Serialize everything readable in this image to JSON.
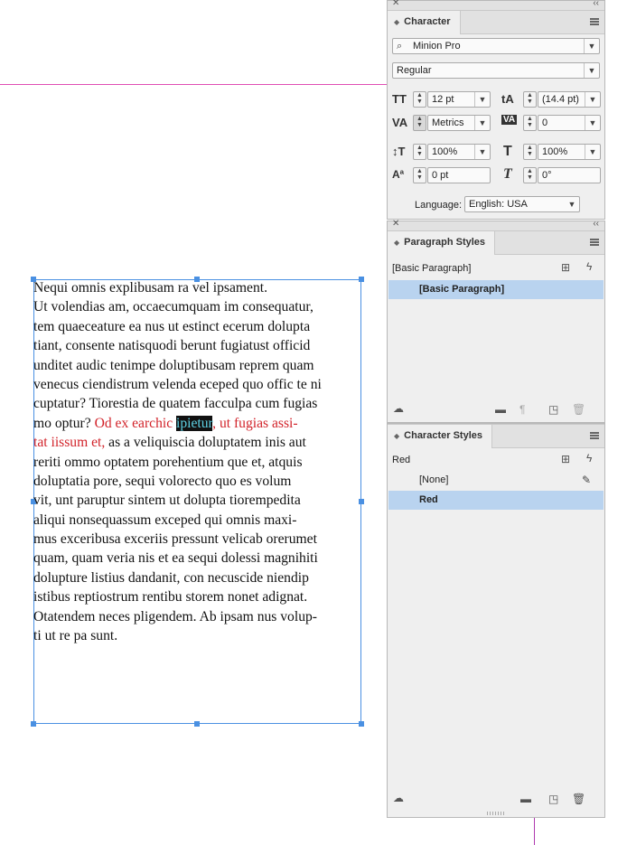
{
  "story": {
    "lines": [
      {
        "segments": [
          {
            "text": "Nequi omnis explibusam ra vel ipsament.",
            "style": "normal"
          }
        ]
      },
      {
        "segments": [
          {
            "text": "Ut volendias am, occaecumquam im consequatur,",
            "style": "normal"
          }
        ]
      },
      {
        "segments": [
          {
            "text": "tem quaeceature ea nus ut estinct ecerum dolupta",
            "style": "normal"
          }
        ]
      },
      {
        "segments": [
          {
            "text": "tiant, consente natisquodi berunt fugiatust officid",
            "style": "normal"
          }
        ]
      },
      {
        "segments": [
          {
            "text": "unditet audic tenimpe doluptibusam reprem quam",
            "style": "normal"
          }
        ]
      },
      {
        "segments": [
          {
            "text": "venecus ciendistrum velenda eceped quo offic te ni",
            "style": "normal"
          }
        ]
      },
      {
        "segments": [
          {
            "text": "cuptatur? Tiorestia de quatem facculpa cum fugias",
            "style": "normal"
          }
        ]
      },
      {
        "segments": [
          {
            "text": "mo optur? ",
            "style": "normal"
          },
          {
            "text": "Od ex earchic ",
            "style": "red"
          },
          {
            "text": "ipietur",
            "style": "selected"
          },
          {
            "text": ", ut fugias assi-",
            "style": "red"
          }
        ]
      },
      {
        "segments": [
          {
            "text": "tat iissum et,",
            "style": "red"
          },
          {
            "text": " as a veliquiscia doluptatem inis aut",
            "style": "normal"
          }
        ]
      },
      {
        "segments": [
          {
            "text": "reriti ommo optatem porehentium que et, atquis",
            "style": "normal"
          }
        ]
      },
      {
        "segments": [
          {
            "text": "doluptatia pore, sequi volorecto quo es volum",
            "style": "normal"
          }
        ]
      },
      {
        "segments": [
          {
            "text": "vit, unt paruptur sintem ut dolupta tiorempedita",
            "style": "normal"
          }
        ]
      },
      {
        "segments": [
          {
            "text": "aliqui nonsequassum exceped qui omnis maxi-",
            "style": "normal"
          }
        ]
      },
      {
        "segments": [
          {
            "text": "mus exceribusa exceriis pressunt velicab orerumet",
            "style": "normal"
          }
        ]
      },
      {
        "segments": [
          {
            "text": "quam, quam veria nis et ea sequi dolessi magnihiti",
            "style": "normal"
          }
        ]
      },
      {
        "segments": [
          {
            "text": "dolupture listius dandanit, con necuscide niendip",
            "style": "normal"
          }
        ]
      },
      {
        "segments": [
          {
            "text": "istibus reptiostrum rentibu storem nonet adignat.",
            "style": "normal"
          }
        ]
      },
      {
        "segments": [
          {
            "text": "Otatendem neces pligendem. Ab ipsam nus volup-",
            "style": "normal"
          }
        ]
      },
      {
        "segments": [
          {
            "text": "ti ut re pa sunt.",
            "style": "normal"
          }
        ]
      }
    ]
  },
  "character_panel": {
    "tab_label": "Character",
    "font_family": "Minion Pro",
    "font_style": "Regular",
    "font_size": "12 pt",
    "leading": "(14.4 pt)",
    "kerning": "Metrics",
    "tracking": "0",
    "vertical_scale": "100%",
    "horizontal_scale": "100%",
    "baseline_shift": "0 pt",
    "skew": "0°",
    "language_label": "Language:",
    "language": "English: USA"
  },
  "paragraph_styles_panel": {
    "tab_label": "Paragraph Styles",
    "current_style": "[Basic Paragraph]",
    "items": [
      "[Basic Paragraph]"
    ]
  },
  "character_styles_panel": {
    "tab_label": "Character Styles",
    "current_style": "Red",
    "items": [
      "[None]",
      "Red"
    ]
  },
  "colors": {
    "accent_red": "#d2232a",
    "selection_blue": "#b9d3ef",
    "frame_blue": "#4a90e2",
    "guide_magenta": "#e04fb4"
  }
}
